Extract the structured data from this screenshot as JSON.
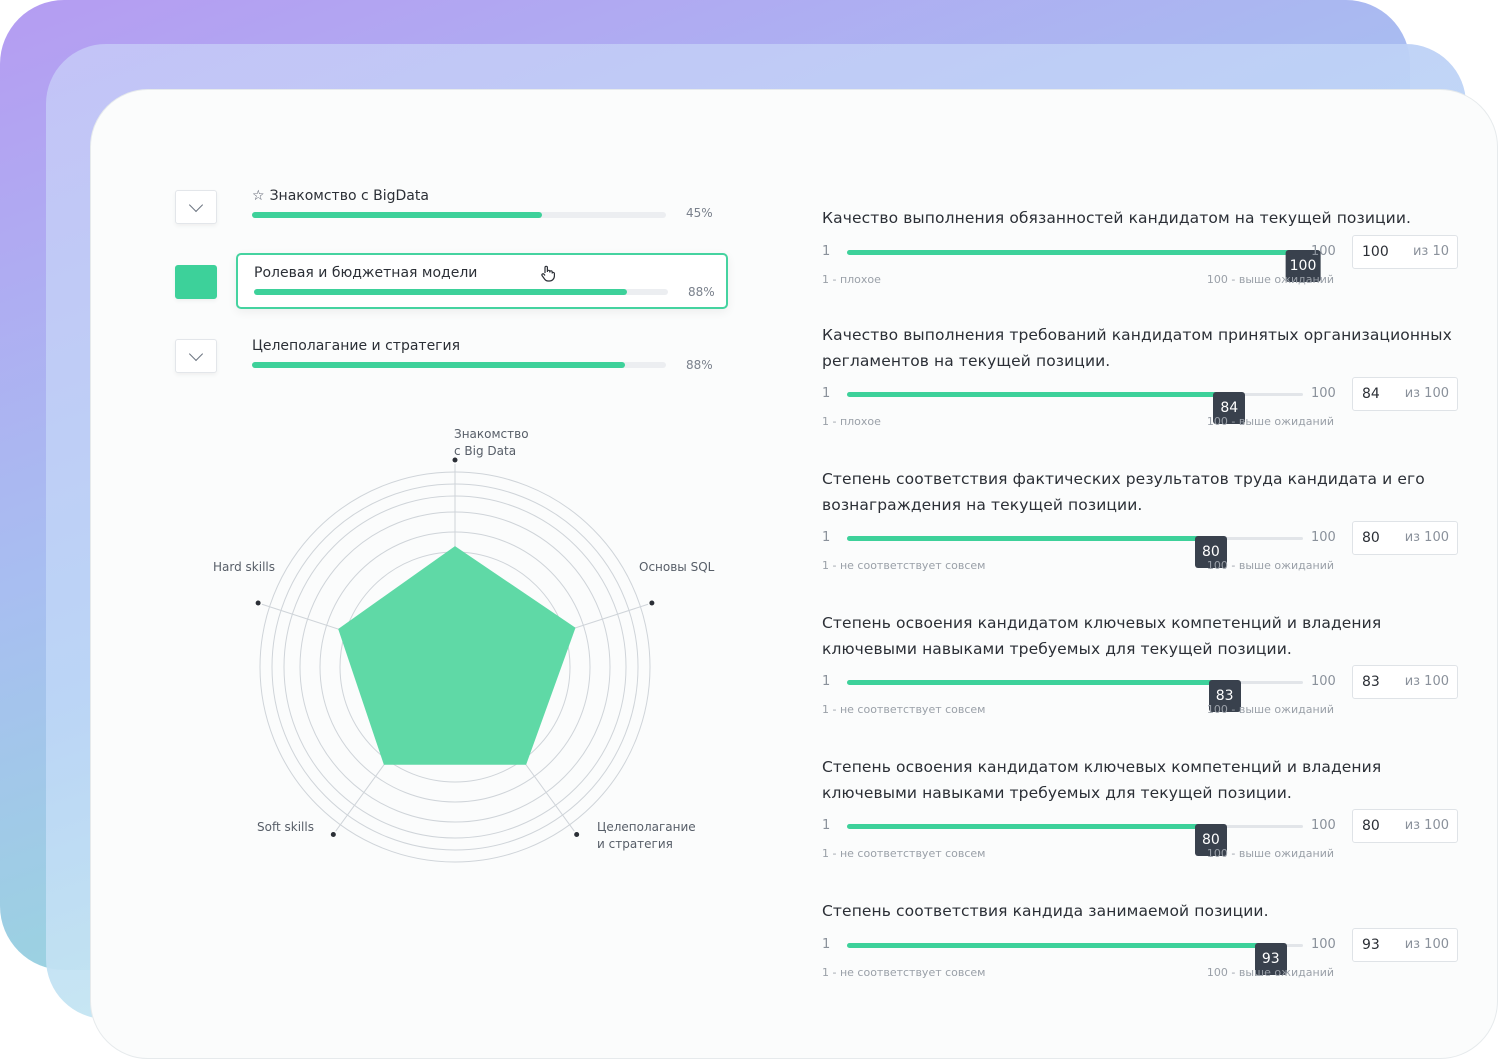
{
  "skills": [
    {
      "label": "Знакомство с BigData",
      "starred": true,
      "percent": "45%",
      "progress": 0.7,
      "toggle_icon": "chevron-down-icon"
    },
    {
      "label": "Ролевая и бюджетная модели",
      "starred": false,
      "percent": "88%",
      "progress": 0.9,
      "toggle_icon": "active-square"
    },
    {
      "label": "Целеполагание и стратегия",
      "starred": false,
      "percent": "88%",
      "progress": 0.9,
      "toggle_icon": "chevron-down-icon"
    }
  ],
  "star_glyph": "☆",
  "radar": {
    "axes": [
      {
        "line1": "Знакомство",
        "line2": "с Big Data"
      },
      {
        "line1": "Основы SQL",
        "line2": ""
      },
      {
        "line1": "Целеполагание",
        "line2": "и стратегия"
      },
      {
        "line1": "Soft skills",
        "line2": ""
      },
      {
        "line1": "Hard skills",
        "line2": ""
      }
    ],
    "values": [
      0.62,
      0.65,
      0.62,
      0.62,
      0.63
    ],
    "fill_color": "#5fd9a6"
  },
  "questions": [
    {
      "title": "Качество выполнения обязанностей кандидатом на текущей позиции.",
      "value": 100,
      "max": 100,
      "min_label": "1",
      "max_label": "100",
      "input_value": "100",
      "out_of": "из 10",
      "scale_low": "1 - плохое",
      "scale_high": "100 - выше ожиданий"
    },
    {
      "title": "Качество выполнения требований кандидатом принятых организационных регламентов на текущей позиции.",
      "value": 84,
      "max": 100,
      "min_label": "1",
      "max_label": "100",
      "input_value": "84",
      "out_of": "из 100",
      "scale_low": "1 - плохое",
      "scale_high": "100 - выше ожиданий"
    },
    {
      "title": "Степень соответствия фактических результатов труда кандидата и его вознаграждения на текущей позиции.",
      "value": 80,
      "max": 100,
      "min_label": "1",
      "max_label": "100",
      "input_value": "80",
      "out_of": "из 100",
      "scale_low": "1 - не соответствует совсем",
      "scale_high": "100 - выше ожиданий"
    },
    {
      "title": "Степень освоения кандидатом ключевых компетенций и владения ключевыми навыками требуемых для текущей позиции.",
      "value": 83,
      "max": 100,
      "min_label": "1",
      "max_label": "100",
      "input_value": "83",
      "out_of": "из 100",
      "scale_low": "1 - не соответствует совсем",
      "scale_high": "100 - выше ожиданий"
    },
    {
      "title": "Степень освоения кандидатом ключевых компетенций и владения ключевыми навыками требуемых для текущей позиции.",
      "value": 80,
      "max": 100,
      "min_label": "1",
      "max_label": "100",
      "input_value": "80",
      "out_of": "из 100",
      "scale_low": "1 - не соответствует совсем",
      "scale_high": "100 - выше ожиданий"
    },
    {
      "title": "Степень соответствия кандида занимаемой позиции.",
      "value": 93,
      "max": 100,
      "min_label": "1",
      "max_label": "100",
      "input_value": "93",
      "out_of": "из 100",
      "scale_low": "1 - не соответствует совсем",
      "scale_high": "100 - выше ожиданий"
    }
  ],
  "colors": {
    "accent": "#3dd19a",
    "thumb": "#39414d"
  }
}
